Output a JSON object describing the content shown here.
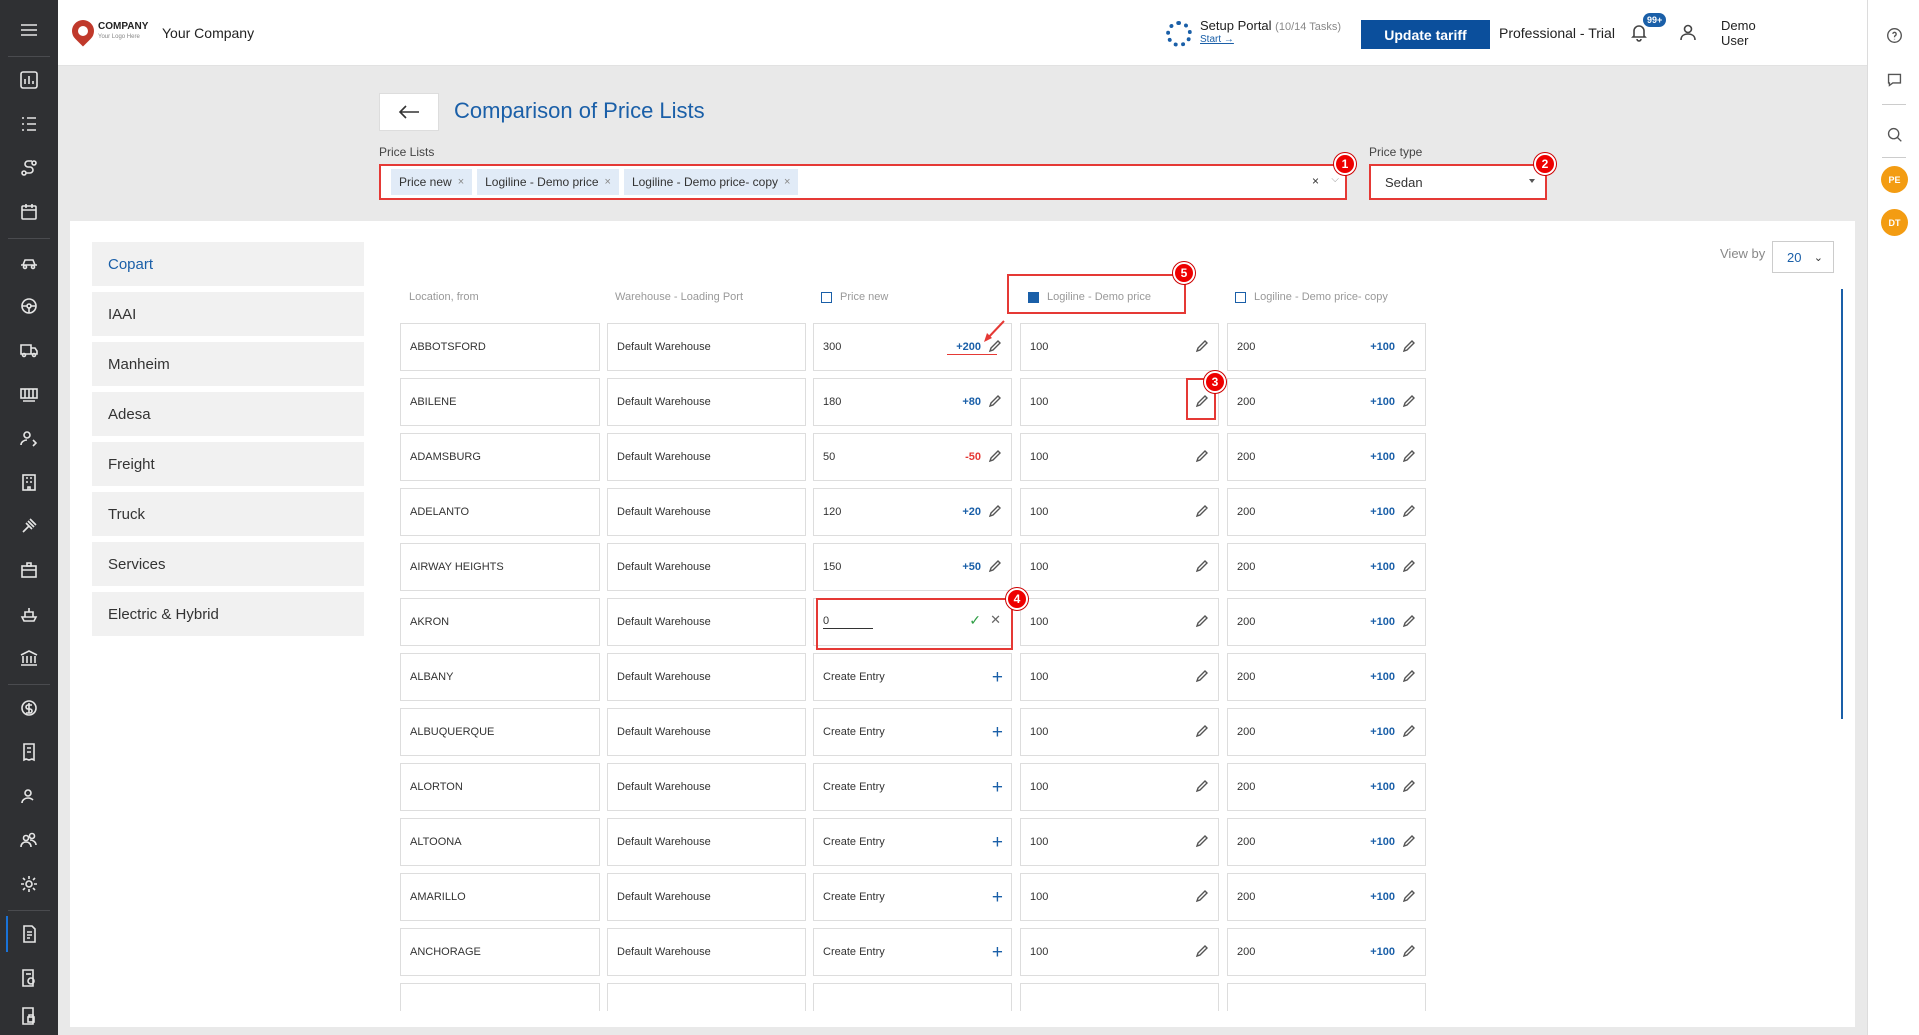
{
  "topbar": {
    "logo_title": "COMPANY",
    "logo_subtitle": "Your Logo Here",
    "company_name": "Your Company",
    "setup_title": "Setup Portal",
    "setup_tasks": "(10/14 Tasks)",
    "setup_link": "Start →",
    "update_button": "Update tariff",
    "plan": "Professional - Trial",
    "notifications_badge": "99+",
    "user_name": "Demo User"
  },
  "page": {
    "title": "Comparison of Price Lists",
    "price_lists_label": "Price Lists",
    "price_type_label": "Price type",
    "price_type_value": "Sedan",
    "selected_lists": [
      "Price new",
      "Logiline - Demo price",
      "Logiline - Demo price- copy"
    ],
    "chip_remove": "×",
    "clear_symbol": "×",
    "dropdown_symbol": "⌵"
  },
  "categories": [
    "Copart",
    "IAAI",
    "Manheim",
    "Adesa",
    "Freight",
    "Truck",
    "Services",
    "Electric & Hybrid"
  ],
  "view": {
    "label": "View by",
    "value": "20"
  },
  "table": {
    "headers": {
      "location": "Location, from",
      "warehouse": "Warehouse - Loading Port",
      "list1": "Price new",
      "list2": "Logiline - Demo price",
      "list3": "Logiline - Demo price- copy"
    },
    "create_label": "Create Entry",
    "rows": [
      {
        "location": "ABBOTSFORD",
        "warehouse": "Default Warehouse",
        "p1": "300",
        "d1": "+200",
        "p2": "100",
        "p3": "200",
        "d3": "+100"
      },
      {
        "location": "ABILENE",
        "warehouse": "Default Warehouse",
        "p1": "180",
        "d1": "+80",
        "p2": "100",
        "p3": "200",
        "d3": "+100"
      },
      {
        "location": "ADAMSBURG",
        "warehouse": "Default Warehouse",
        "p1": "50",
        "d1": "-50",
        "p2": "100",
        "p3": "200",
        "d3": "+100"
      },
      {
        "location": "ADELANTO",
        "warehouse": "Default Warehouse",
        "p1": "120",
        "d1": "+20",
        "p2": "100",
        "p3": "200",
        "d3": "+100"
      },
      {
        "location": "AIRWAY HEIGHTS",
        "warehouse": "Default Warehouse",
        "p1": "150",
        "d1": "+50",
        "p2": "100",
        "p3": "200",
        "d3": "+100"
      },
      {
        "location": "AKRON",
        "warehouse": "Default Warehouse",
        "p1": "0",
        "d1": "",
        "p2": "100",
        "p3": "200",
        "d3": "+100",
        "editing": true
      },
      {
        "location": "ALBANY",
        "warehouse": "Default Warehouse",
        "p1": "",
        "d1": "",
        "p2": "100",
        "p3": "200",
        "d3": "+100",
        "create": true
      },
      {
        "location": "ALBUQUERQUE",
        "warehouse": "Default Warehouse",
        "p1": "",
        "d1": "",
        "p2": "100",
        "p3": "200",
        "d3": "+100",
        "create": true
      },
      {
        "location": "ALORTON",
        "warehouse": "Default Warehouse",
        "p1": "",
        "d1": "",
        "p2": "100",
        "p3": "200",
        "d3": "+100",
        "create": true
      },
      {
        "location": "ALTOONA",
        "warehouse": "Default Warehouse",
        "p1": "",
        "d1": "",
        "p2": "100",
        "p3": "200",
        "d3": "+100",
        "create": true
      },
      {
        "location": "AMARILLO",
        "warehouse": "Default Warehouse",
        "p1": "",
        "d1": "",
        "p2": "100",
        "p3": "200",
        "d3": "+100",
        "create": true
      },
      {
        "location": "ANCHORAGE",
        "warehouse": "Default Warehouse",
        "p1": "",
        "d1": "",
        "p2": "100",
        "p3": "200",
        "d3": "+100",
        "create": true
      },
      {
        "location": "",
        "warehouse": "",
        "p1": "",
        "d1": "",
        "p2": "",
        "p3": "",
        "d3": "",
        "partial": true
      }
    ]
  },
  "markers": [
    "1",
    "2",
    "3",
    "4",
    "5"
  ],
  "right_rail": {
    "avatar1": "PE",
    "avatar2": "DT"
  },
  "colors": {
    "brand": "#1a5fa8",
    "button": "#0b4f9c",
    "negative": "#e53935",
    "annotation": "#e00000",
    "avatar": "#f39c12"
  }
}
